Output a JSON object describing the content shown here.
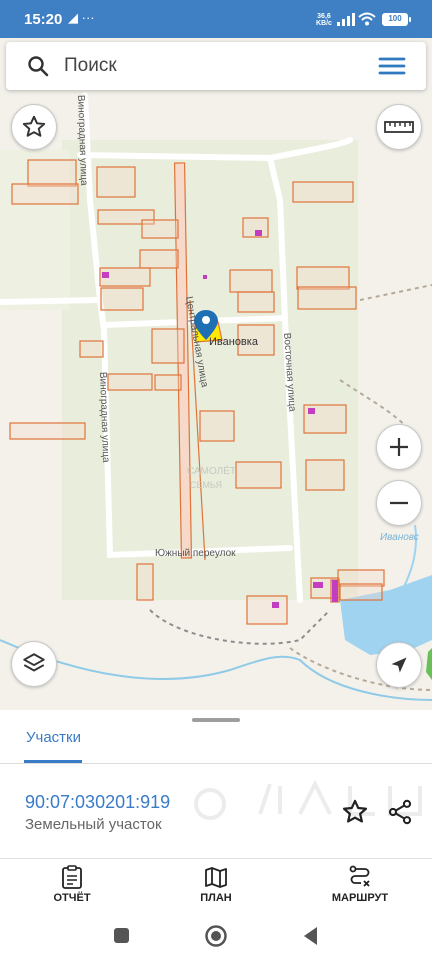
{
  "status_bar": {
    "time": "15:20",
    "left_icons": "◢ ···",
    "net_speed_value": "36,6",
    "net_speed_unit": "KB/c",
    "battery": "100"
  },
  "search": {
    "placeholder": "Поиск",
    "value": ""
  },
  "map": {
    "labels": {
      "vinogradnaya_north": "Виноградная улица",
      "vinogradnaya_south": "Виноградная улица",
      "centralnaya": "Центральная улица",
      "vostochnaya": "Восточная улица",
      "yuzhny": "Южный переулок",
      "village": "Ивановка",
      "water_label": "Ивановс",
      "map_watermark": "САМОЛЁТ",
      "map_watermark_sub": "СЕМЬЯ"
    },
    "colors": {
      "parcel_stroke": "#e0733a",
      "parcel_fill": "#f6d9c8",
      "selected_fill": "#ffe900",
      "pin": "#1f6fb5",
      "building": "#c33dc1",
      "water": "#9fd3f0"
    }
  },
  "sheet": {
    "tab_label": "Участки",
    "parcel_number": "90:07:030201:919",
    "parcel_type": "Земельный участок"
  },
  "bottom_nav": {
    "report_label": "ОТЧЁТ",
    "plan_label": "ПЛАН",
    "route_label": "МАРШРУТ"
  }
}
